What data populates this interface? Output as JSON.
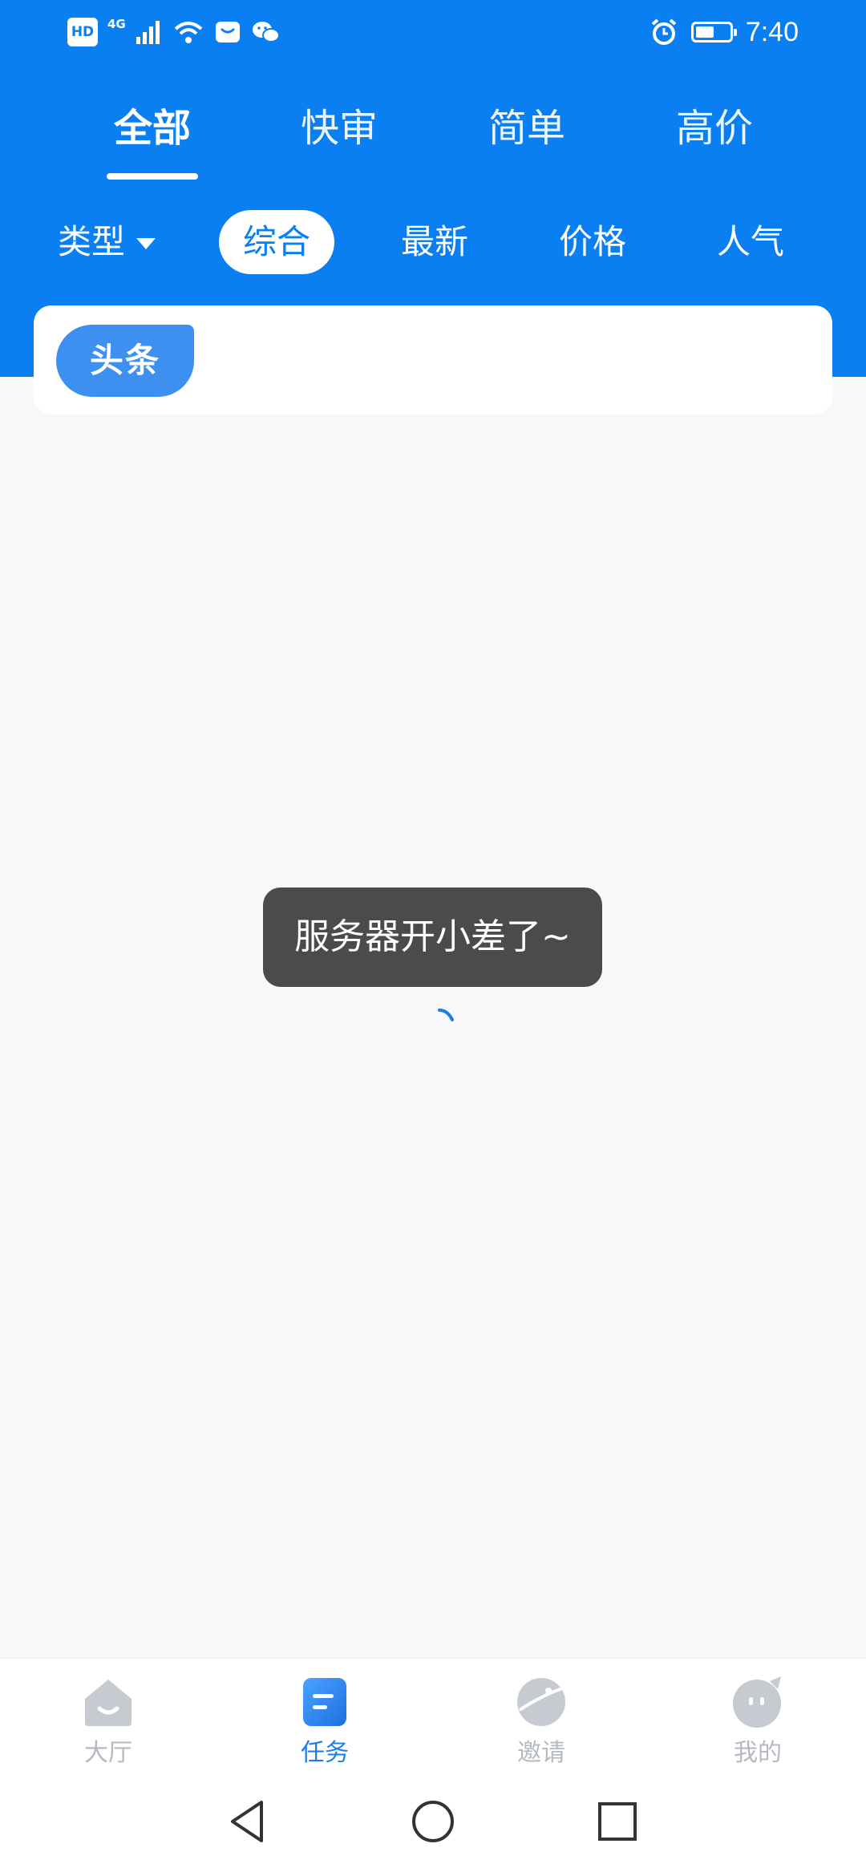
{
  "status_bar": {
    "hd_label": "HD",
    "network_label": "4G",
    "time": "7:40",
    "battery_level": 0.55,
    "icons": [
      "signal-icon",
      "wifi-icon",
      "huawei-app-icon",
      "wechat-icon",
      "alarm-icon",
      "battery-icon"
    ]
  },
  "main_tabs": [
    {
      "label": "全部",
      "active": true
    },
    {
      "label": "快审",
      "active": false
    },
    {
      "label": "简单",
      "active": false
    },
    {
      "label": "高价",
      "active": false
    }
  ],
  "filters": {
    "type_label": "类型",
    "options": [
      {
        "label": "综合",
        "active": true
      },
      {
        "label": "最新",
        "active": false
      },
      {
        "label": "价格",
        "active": false
      },
      {
        "label": "人气",
        "active": false
      }
    ]
  },
  "headline": {
    "badge": "头条"
  },
  "toast": {
    "message": "服务器开小差了~"
  },
  "bottom_nav": [
    {
      "label": "大厅",
      "icon": "house-icon",
      "active": false
    },
    {
      "label": "任务",
      "icon": "task-icon",
      "active": true
    },
    {
      "label": "邀请",
      "icon": "planet-icon",
      "active": false
    },
    {
      "label": "我的",
      "icon": "face-icon",
      "active": false
    }
  ],
  "colors": {
    "brand_blue": "#0a7ff2",
    "badge_blue": "#3d90f0",
    "toast_bg": "#4b4b4b",
    "inactive_nav": "#b5bac2",
    "active_nav": "#1a7ee6",
    "page_bg": "#f8f8fa"
  }
}
